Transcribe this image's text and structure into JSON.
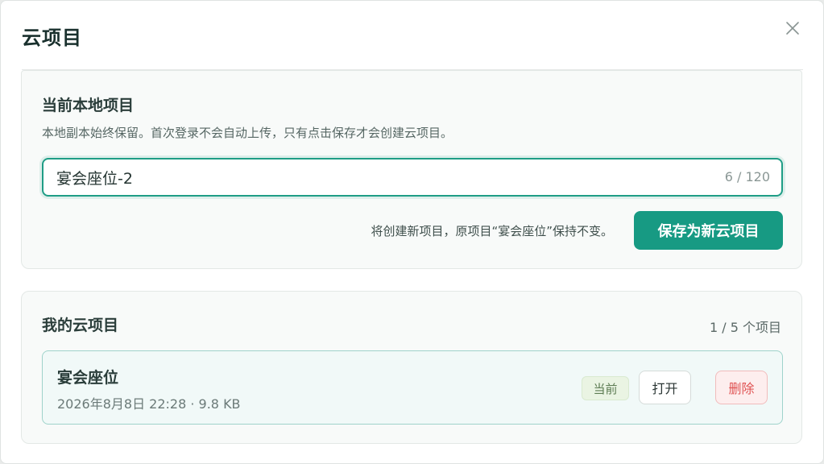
{
  "dialog": {
    "title": "云项目",
    "close_icon": "close-icon"
  },
  "local_project": {
    "title": "当前本地项目",
    "description": "本地副本始终保留。首次登录不会自动上传，只有点击保存才会创建云项目。",
    "name_input": {
      "value": "宴会座位-2",
      "char_count": "6 / 120"
    },
    "save_hint": "将创建新项目，原项目“宴会座位”保持不变。",
    "save_button_label": "保存为新云项目"
  },
  "cloud_projects": {
    "title": "我的云项目",
    "count_label": "1 / 5 个项目",
    "items": [
      {
        "name": "宴会座位",
        "meta": "2026年8月8日 22:28 · 9.8 KB",
        "badge": "当前",
        "open_label": "打开",
        "delete_label": "删除"
      }
    ]
  },
  "colors": {
    "accent": "#179a83",
    "danger": "#e05454",
    "current_badge_bg": "#eaf4e3"
  }
}
